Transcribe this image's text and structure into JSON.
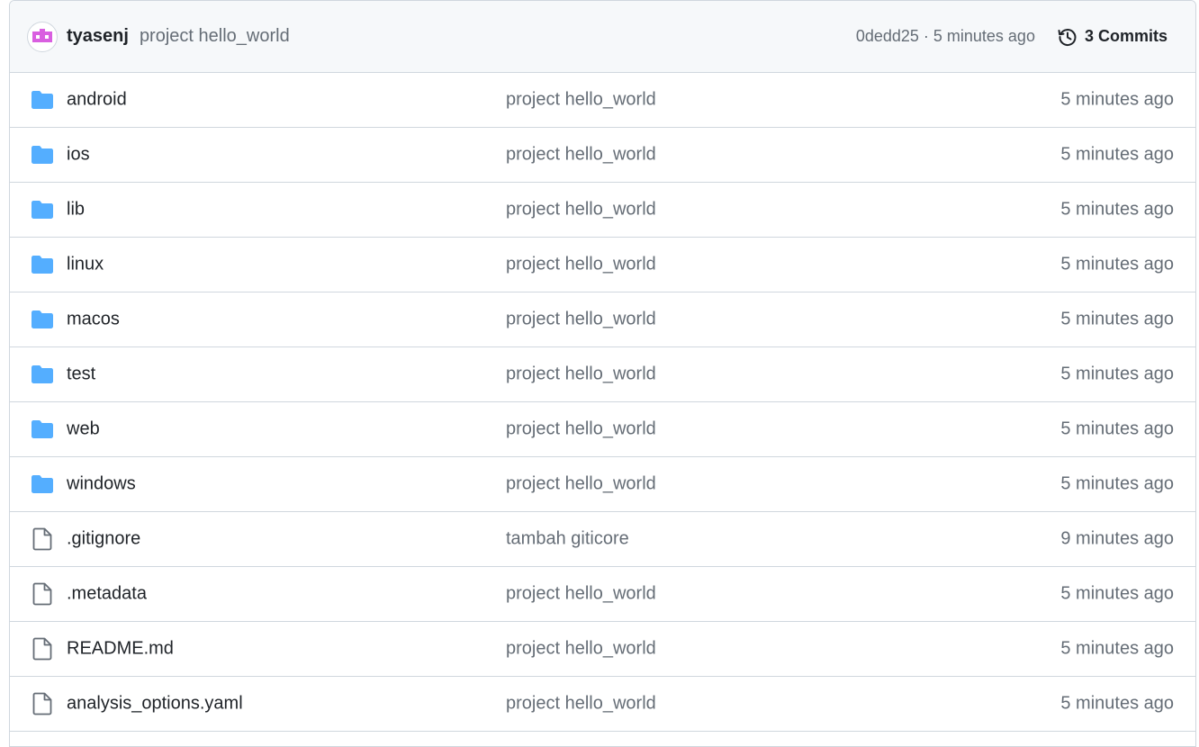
{
  "latest_commit": {
    "author": "tyasenj",
    "message": "project hello_world",
    "hash_time": "0dedd25 · 5 minutes ago",
    "commits_label": "3 Commits",
    "avatar_icon": "identicon-avatar",
    "history_icon": "history-icon"
  },
  "colors": {
    "folder": "#54aeff",
    "file": "#656d76",
    "avatar": "#d95fe0",
    "border": "#d0d7de",
    "header_bg": "#f6f8fa",
    "muted_text": "#656d76"
  },
  "files": [
    {
      "type": "folder",
      "name": "android",
      "commit": "project hello_world",
      "age": "5 minutes ago"
    },
    {
      "type": "folder",
      "name": "ios",
      "commit": "project hello_world",
      "age": "5 minutes ago"
    },
    {
      "type": "folder",
      "name": "lib",
      "commit": "project hello_world",
      "age": "5 minutes ago"
    },
    {
      "type": "folder",
      "name": "linux",
      "commit": "project hello_world",
      "age": "5 minutes ago"
    },
    {
      "type": "folder",
      "name": "macos",
      "commit": "project hello_world",
      "age": "5 minutes ago"
    },
    {
      "type": "folder",
      "name": "test",
      "commit": "project hello_world",
      "age": "5 minutes ago"
    },
    {
      "type": "folder",
      "name": "web",
      "commit": "project hello_world",
      "age": "5 minutes ago"
    },
    {
      "type": "folder",
      "name": "windows",
      "commit": "project hello_world",
      "age": "5 minutes ago"
    },
    {
      "type": "file",
      "name": ".gitignore",
      "commit": "tambah giticore",
      "age": "9 minutes ago"
    },
    {
      "type": "file",
      "name": ".metadata",
      "commit": "project hello_world",
      "age": "5 minutes ago"
    },
    {
      "type": "file",
      "name": "README.md",
      "commit": "project hello_world",
      "age": "5 minutes ago"
    },
    {
      "type": "file",
      "name": "analysis_options.yaml",
      "commit": "project hello_world",
      "age": "5 minutes ago"
    }
  ]
}
